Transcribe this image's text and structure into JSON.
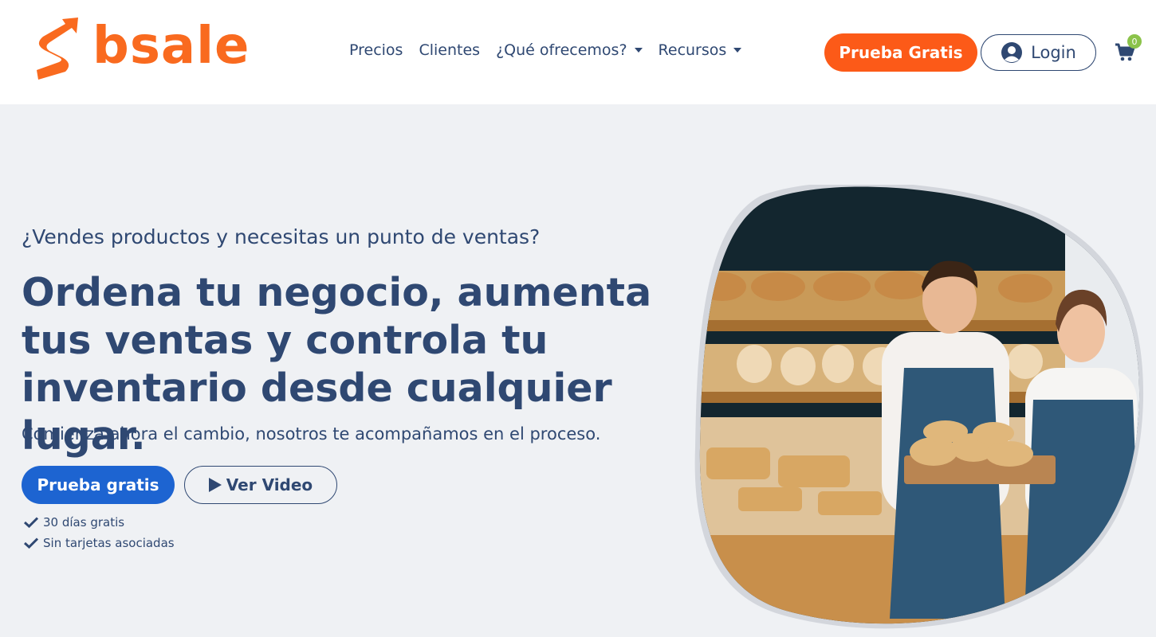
{
  "brand": {
    "name": "bsale",
    "color": "#f96a1f"
  },
  "nav": {
    "items": [
      {
        "label": "Precios",
        "dropdown": false
      },
      {
        "label": "Clientes",
        "dropdown": false
      },
      {
        "label": "¿Qué ofrecemos?",
        "dropdown": true
      },
      {
        "label": "Recursos",
        "dropdown": true
      }
    ]
  },
  "header": {
    "trial_label": "Prueba Gratis",
    "login_label": "Login",
    "cart_count": "0"
  },
  "hero": {
    "eyebrow": "¿Vendes productos y necesitas un punto de ventas?",
    "headline": "Ordena tu negocio, aumenta tus ventas y controla tu inventario desde cualquier lugar.",
    "subline": "Comienza ahora el cambio, nosotros te acompañamos en el proceso.",
    "trial_label": "Prueba gratis",
    "video_label": "Ver Video",
    "benefits": [
      "30 días gratis",
      "Sin tarjetas asociadas"
    ]
  },
  "colors": {
    "navy": "#2f4872",
    "orange": "#fc5a18",
    "blue": "#1d64d1",
    "background": "#eff1f4",
    "badge": "#8bc34a"
  },
  "icons": [
    "bsale-logo-icon",
    "chevron-down-icon",
    "user-circle-icon",
    "cart-icon",
    "play-icon",
    "check-icon"
  ]
}
